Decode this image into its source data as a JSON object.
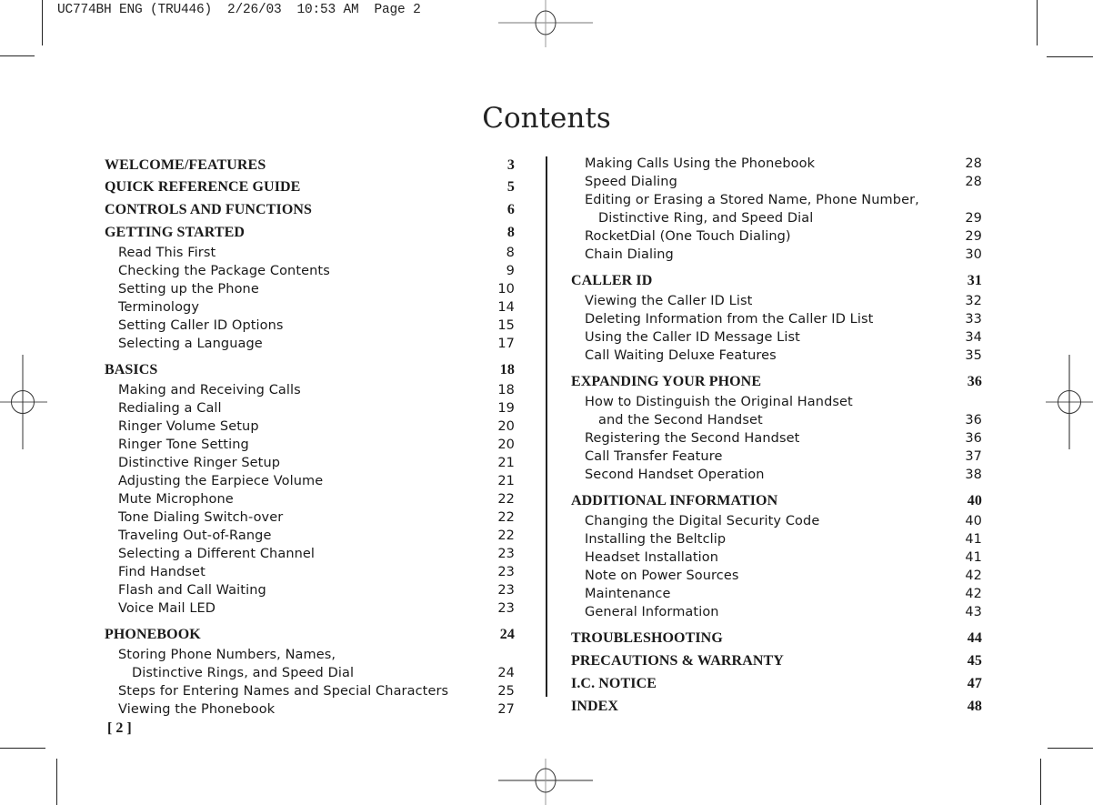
{
  "print_header": "UC774BH ENG (TRU446)  2/26/03  10:53 AM  Page 2",
  "title": "Contents",
  "folio": "[ 2 ]",
  "left_column": [
    {
      "type": "head",
      "label": "WELCOME/FEATURES",
      "page": "3"
    },
    {
      "type": "head",
      "label": "QUICK REFERENCE GUIDE",
      "page": "5"
    },
    {
      "type": "head",
      "label": "CONTROLS AND FUNCTIONS",
      "page": "6"
    },
    {
      "type": "head",
      "label": "GETTING STARTED",
      "page": "8"
    },
    {
      "type": "sub",
      "label": "Read This First",
      "page": "8"
    },
    {
      "type": "sub",
      "label": "Checking the Package Contents",
      "page": "9"
    },
    {
      "type": "sub",
      "label": "Setting up the Phone",
      "page": "10"
    },
    {
      "type": "sub",
      "label": "Terminology",
      "page": "14"
    },
    {
      "type": "sub",
      "label": "Setting Caller ID Options",
      "page": "15"
    },
    {
      "type": "sub",
      "label": "Selecting a Language",
      "page": "17"
    },
    {
      "type": "head",
      "label": "BASICS",
      "page": "18"
    },
    {
      "type": "sub",
      "label": "Making and Receiving Calls",
      "page": "18"
    },
    {
      "type": "sub",
      "label": "Redialing a Call",
      "page": "19"
    },
    {
      "type": "sub",
      "label": "Ringer Volume Setup",
      "page": "20"
    },
    {
      "type": "sub",
      "label": "Ringer Tone Setting",
      "page": "20"
    },
    {
      "type": "sub",
      "label": "Distinctive Ringer Setup",
      "page": "21"
    },
    {
      "type": "sub",
      "label": "Adjusting the Earpiece Volume",
      "page": "21"
    },
    {
      "type": "sub",
      "label": "Mute Microphone",
      "page": "22"
    },
    {
      "type": "sub",
      "label": "Tone Dialing Switch-over",
      "page": "22"
    },
    {
      "type": "sub",
      "label": "Traveling Out-of-Range",
      "page": "22"
    },
    {
      "type": "sub",
      "label": "Selecting a Different Channel",
      "page": "23"
    },
    {
      "type": "sub",
      "label": "Find Handset",
      "page": "23"
    },
    {
      "type": "sub",
      "label": "Flash and Call Waiting",
      "page": "23"
    },
    {
      "type": "sub",
      "label": "Voice Mail LED",
      "page": "23"
    },
    {
      "type": "head",
      "label": "PHONEBOOK",
      "page": "24"
    },
    {
      "type": "sub",
      "label": "Storing Phone Numbers, Names,",
      "page": ""
    },
    {
      "type": "cont",
      "label": "Distinctive Rings, and Speed Dial",
      "page": "24"
    },
    {
      "type": "sub",
      "label": "Steps for Entering Names and Special Characters",
      "page": "25"
    },
    {
      "type": "sub",
      "label": "Viewing the Phonebook",
      "page": "27"
    }
  ],
  "right_column": [
    {
      "type": "sub",
      "label": "Making Calls Using the Phonebook",
      "page": "28"
    },
    {
      "type": "sub",
      "label": "Speed Dialing",
      "page": "28"
    },
    {
      "type": "sub",
      "label": "Editing or Erasing a Stored Name, Phone Number,",
      "page": ""
    },
    {
      "type": "cont",
      "label": "Distinctive Ring, and Speed Dial",
      "page": "29"
    },
    {
      "type": "sub",
      "label": "RocketDial (One Touch Dialing)",
      "page": "29"
    },
    {
      "type": "sub",
      "label": "Chain Dialing",
      "page": "30"
    },
    {
      "type": "head",
      "label": "CALLER ID",
      "page": "31"
    },
    {
      "type": "sub",
      "label": "Viewing the Caller ID List",
      "page": "32"
    },
    {
      "type": "sub",
      "label": "Deleting Information from the Caller ID List",
      "page": "33"
    },
    {
      "type": "sub",
      "label": "Using the Caller ID Message List",
      "page": "34"
    },
    {
      "type": "sub",
      "label": "Call Waiting Deluxe Features",
      "page": "35"
    },
    {
      "type": "head",
      "label": "EXPANDING YOUR PHONE",
      "page": "36"
    },
    {
      "type": "sub",
      "label": "How to Distinguish the Original Handset",
      "page": ""
    },
    {
      "type": "cont",
      "label": "and the Second Handset",
      "page": "36"
    },
    {
      "type": "sub",
      "label": "Registering the Second Handset",
      "page": "36"
    },
    {
      "type": "sub",
      "label": "Call Transfer Feature",
      "page": "37"
    },
    {
      "type": "sub",
      "label": "Second Handset Operation",
      "page": "38"
    },
    {
      "type": "head",
      "label": "ADDITIONAL INFORMATION",
      "page": "40"
    },
    {
      "type": "sub",
      "label": "Changing the Digital Security Code",
      "page": "40"
    },
    {
      "type": "sub",
      "label": "Installing the Beltclip",
      "page": "41"
    },
    {
      "type": "sub",
      "label": "Headset Installation",
      "page": "41"
    },
    {
      "type": "sub",
      "label": "Note on Power Sources",
      "page": "42"
    },
    {
      "type": "sub",
      "label": "Maintenance",
      "page": "42"
    },
    {
      "type": "sub",
      "label": "General Information",
      "page": "43"
    },
    {
      "type": "head",
      "label": "TROUBLESHOOTING",
      "page": "44"
    },
    {
      "type": "head",
      "label": "PRECAUTIONS & WARRANTY",
      "page": "45"
    },
    {
      "type": "head",
      "label": "I.C. NOTICE",
      "page": "47"
    },
    {
      "type": "head",
      "label": "INDEX",
      "page": "48"
    }
  ]
}
